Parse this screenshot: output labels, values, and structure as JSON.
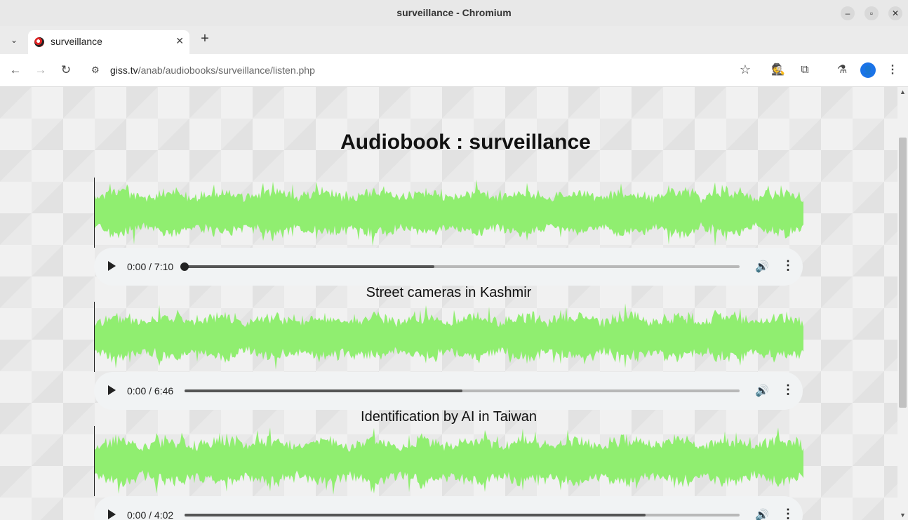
{
  "window": {
    "title": "surveillance - Chromium",
    "controls": {
      "minimize": "–",
      "maximize": "▫",
      "close": "✕"
    }
  },
  "tabs": [
    {
      "label": "surveillance",
      "close": "✕",
      "favicon": "giss-icon"
    }
  ],
  "new_tab_symbol": "+",
  "toolbar": {
    "back": "←",
    "forward": "→",
    "reload": "↻",
    "site_info": "⚙",
    "url_host": "giss.tv",
    "url_path": "/anab/audiobooks/surveillance/listen.php",
    "bookmark": "☆",
    "ext1": "🕵",
    "extensions": "⧉",
    "labs": "⚗",
    "profile": "👤",
    "menu": "⋮"
  },
  "page": {
    "title": "Audiobook : surveillance",
    "accent_color": "#90ee70",
    "tracks": [
      {
        "title": "",
        "time": "0:00 / 7:10",
        "buffered": 0.45,
        "played": 0.0
      },
      {
        "title": "Street cameras in Kashmir",
        "time": "0:00 / 6:46",
        "buffered": 0.5,
        "played": 0.0
      },
      {
        "title": "Identification by AI in Taiwan",
        "time": "0:00 / 4:02",
        "buffered": 0.83,
        "played": 0.0
      }
    ]
  },
  "player_icons": {
    "play": "play-icon",
    "volume": "🔊",
    "more": "⋮"
  }
}
